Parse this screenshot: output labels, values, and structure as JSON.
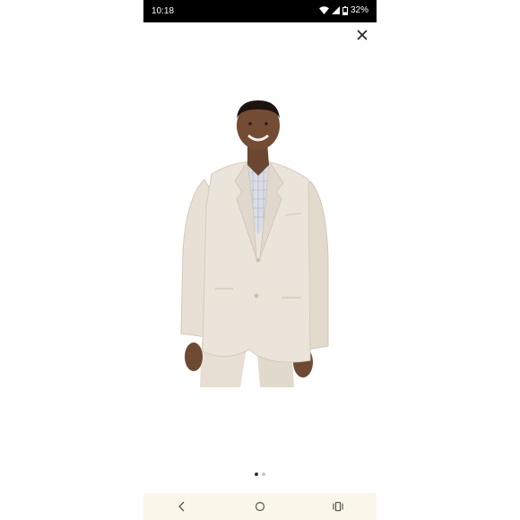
{
  "status_bar": {
    "time": "10:18",
    "battery_percent": "32%",
    "icons": [
      "wifi-icon",
      "cell-signal-icon",
      "battery-icon"
    ]
  },
  "viewer": {
    "close_icon": "close-icon",
    "image_description": "man-in-light-beige-linen-suit",
    "page_count": 2,
    "current_page": 1
  },
  "nav_bar": {
    "icons": [
      "back-icon",
      "home-icon",
      "recents-icon"
    ],
    "background": "#fbf6ea"
  }
}
